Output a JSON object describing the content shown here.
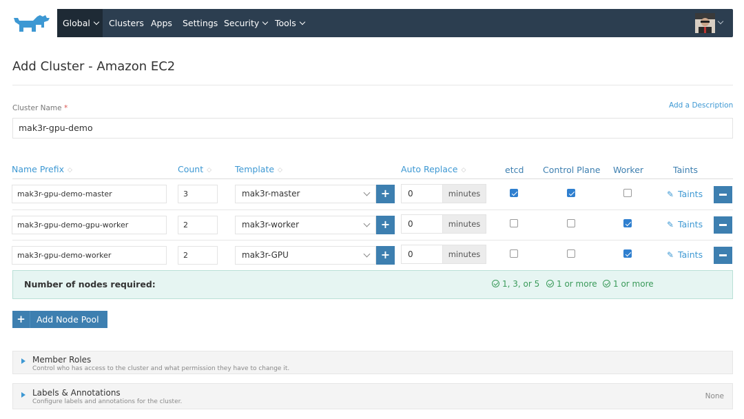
{
  "header": {
    "logo_icon": "rancher-cow-logo-icon",
    "nav": {
      "global": "Global",
      "clusters": "Clusters",
      "apps": "Apps",
      "settings": "Settings",
      "security": "Security",
      "tools": "Tools"
    },
    "avatar_icon": "user-avatar-icon"
  },
  "page": {
    "title": "Add Cluster - Amazon EC2",
    "add_description": "Add a Description"
  },
  "cluster_name": {
    "label": "Cluster Name",
    "required_mark": "*",
    "value": "mak3r-gpu-demo"
  },
  "table": {
    "headers": {
      "name_prefix": "Name Prefix",
      "count": "Count",
      "template": "Template",
      "auto_replace": "Auto Replace",
      "etcd": "etcd",
      "control_plane": "Control Plane",
      "worker": "Worker",
      "taints": "Taints"
    },
    "rows": [
      {
        "name_prefix": "mak3r-gpu-demo-master",
        "count": "3",
        "template": "mak3r-master",
        "auto_replace": "0",
        "unit": "minutes",
        "etcd": true,
        "control_plane": true,
        "worker": false,
        "taints": "Taints"
      },
      {
        "name_prefix": "mak3r-gpu-demo-gpu-worker",
        "count": "2",
        "template": "mak3r-worker",
        "auto_replace": "0",
        "unit": "minutes",
        "etcd": false,
        "control_plane": false,
        "worker": true,
        "taints": "Taints"
      },
      {
        "name_prefix": "mak3r-gpu-demo-worker",
        "count": "2",
        "template": "mak3r-GPU",
        "auto_replace": "0",
        "unit": "minutes",
        "etcd": false,
        "control_plane": false,
        "worker": true,
        "taints": "Taints"
      }
    ]
  },
  "summary": {
    "label": "Number of nodes required:",
    "etcd_req": "1, 3, or 5",
    "control_plane_req": "1 or more",
    "worker_req": "1 or more"
  },
  "add_node_pool": "Add Node Pool",
  "accordions": {
    "member_roles": {
      "title": "Member Roles",
      "desc": "Control who has access to the cluster and what permission they have to change it."
    },
    "labels": {
      "title": "Labels & Annotations",
      "desc": "Configure labels and annotations for the cluster.",
      "status": "None"
    }
  },
  "colors": {
    "nav_bg": "#2c3e50",
    "accent": "#3d7fb0",
    "link": "#3d98d3",
    "ok_green": "#3a9a5a",
    "summary_bg": "#e6f5f2"
  }
}
